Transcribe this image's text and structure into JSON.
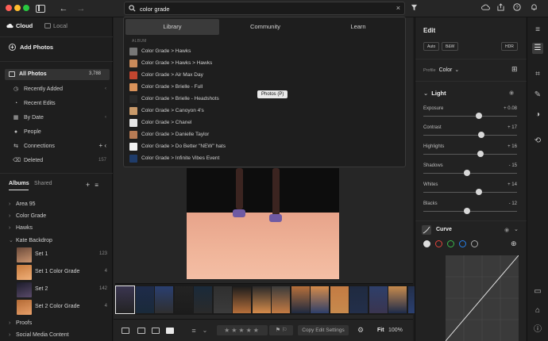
{
  "toolbar": {
    "search_value": "color grade",
    "filter_icon": "filter-icon"
  },
  "sidebar": {
    "tabs": [
      {
        "label": "Cloud"
      },
      {
        "label": "Local"
      }
    ],
    "add_photos": "Add Photos",
    "all_photos": {
      "label": "All Photos",
      "count": "3,788"
    },
    "items": [
      {
        "label": "Recently Added",
        "aux": "‹"
      },
      {
        "label": "Recent Edits",
        "aux": ""
      },
      {
        "label": "By Date",
        "aux": "‹"
      },
      {
        "label": "People",
        "aux": ""
      },
      {
        "label": "Connections",
        "aux": "+ ‹"
      },
      {
        "label": "Deleted",
        "aux": "157"
      }
    ],
    "album_tabs": [
      {
        "label": "Albums"
      },
      {
        "label": "Shared"
      }
    ],
    "folders": [
      {
        "label": "Area 95"
      },
      {
        "label": "Color Grade"
      },
      {
        "label": "Hawks"
      },
      {
        "label": "Kate Backdrop"
      }
    ],
    "albums": [
      {
        "label": "Set 1",
        "count": "123"
      },
      {
        "label": "Set 1 Color Grade",
        "count": "4"
      },
      {
        "label": "Set 2",
        "count": "142"
      },
      {
        "label": "Set 2 Color Grade",
        "count": "4"
      }
    ],
    "bottom_folders": [
      {
        "label": "Proofs"
      },
      {
        "label": "Social Media Content"
      }
    ]
  },
  "search_dropdown": {
    "tabs": [
      {
        "label": "Library"
      },
      {
        "label": "Community"
      },
      {
        "label": "Learn"
      }
    ],
    "section_label": "ALBUM",
    "results": [
      {
        "label": "Color Grade > Hawks"
      },
      {
        "label": "Color Grade > Hawks > Hawks"
      },
      {
        "label": "Color Grade > Air Max Day"
      },
      {
        "label": "Color Grade > Brielle - Full"
      },
      {
        "label": "Color Grade > Brielle - Headshots"
      },
      {
        "label": "Color Grade > Canoyon 4's"
      },
      {
        "label": "Color Grade > Chanel"
      },
      {
        "label": "Color Grade > Danielle Taylor"
      },
      {
        "label": "Color Grade > Do Better \"NEW\" hats"
      },
      {
        "label": "Color Grade > Infinite Vibes Event"
      }
    ],
    "tooltip": "Photos (P)"
  },
  "bottombar": {
    "copy_label": "Copy Edit Settings",
    "fit_label": "Fit",
    "zoom_label": "100%"
  },
  "edit_panel": {
    "title": "Edit",
    "buttons": [
      {
        "label": "Auto"
      },
      {
        "label": "B&W"
      },
      {
        "label": "HDR"
      }
    ],
    "profile_label": "Profile",
    "profile_value": "Color",
    "light_label": "Light",
    "sliders": [
      {
        "name": "Exposure",
        "value": "+ 0.08",
        "level": 0.59
      },
      {
        "name": "Contrast",
        "value": "+ 17",
        "level": 0.62
      },
      {
        "name": "Highlights",
        "value": "+ 16",
        "level": 0.61
      },
      {
        "name": "Shadows",
        "value": "- 15",
        "level": 0.47
      },
      {
        "name": "Whites",
        "value": "+ 14",
        "level": 0.59
      },
      {
        "name": "Blacks",
        "value": "- 12",
        "level": 0.47
      }
    ],
    "curve_label": "Curve"
  },
  "colors": {
    "accent": "#2680eb",
    "selection": "#3a3a3a",
    "floor": "#f0b59a"
  }
}
